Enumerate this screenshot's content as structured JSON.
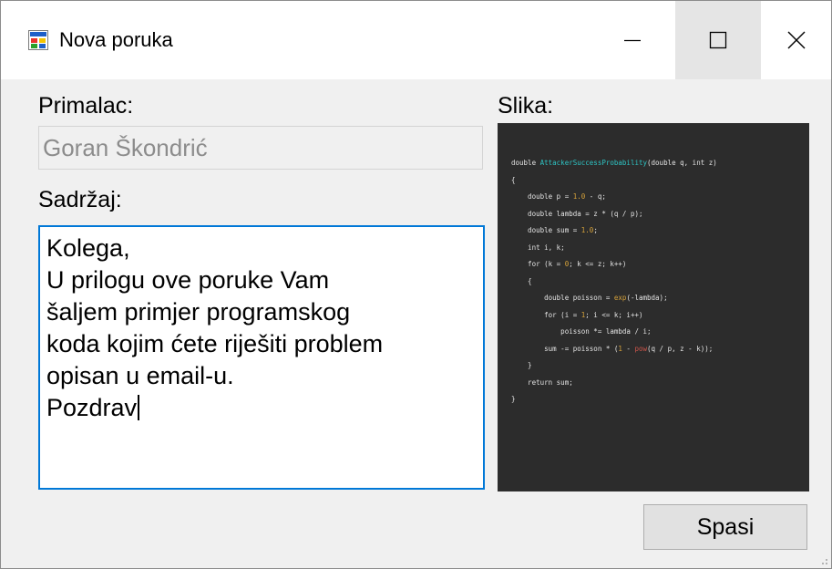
{
  "window": {
    "title": "Nova poruka",
    "icon": "windows-form-icon"
  },
  "controls": {
    "minimize": "minimize-icon",
    "maximize": "maximize-icon",
    "close": "close-icon"
  },
  "form": {
    "recipient_label": "Primalac:",
    "recipient_value": "Goran Škondrić",
    "content_label": "Sadržaj:",
    "content_lines": [
      "Kolega,",
      "U prilogu ove poruke Vam",
      "šaljem primjer programskog",
      "koda kojim ćete riješiti problem",
      "opisan u email-u.",
      "Pozdrav"
    ],
    "image_label": "Slika:",
    "save_label": "Spasi"
  },
  "code_image": {
    "lines": [
      "double AttackerSuccessProbability(double q, int z)",
      "{",
      "    double p = 1.0 - q;",
      "    double lambda = z * (q / p);",
      "    double sum = 1.0;",
      "    int i, k;",
      "    for (k = 0; k <= z; k++)",
      "    {",
      "        double poisson = exp(-lambda);",
      "        for (i = 1; i <= k; i++)",
      "            poisson *= lambda / i;",
      "        sum -= poisson * (1 - pow(q / p, z - k));",
      "    }",
      "    return sum;",
      "}"
    ]
  },
  "colors": {
    "focus_border": "#0078d7",
    "code_background": "#2c2c2c",
    "code_function": "#2ec4c4",
    "code_number": "#d6a23a",
    "code_builtin": "#d0564c"
  }
}
